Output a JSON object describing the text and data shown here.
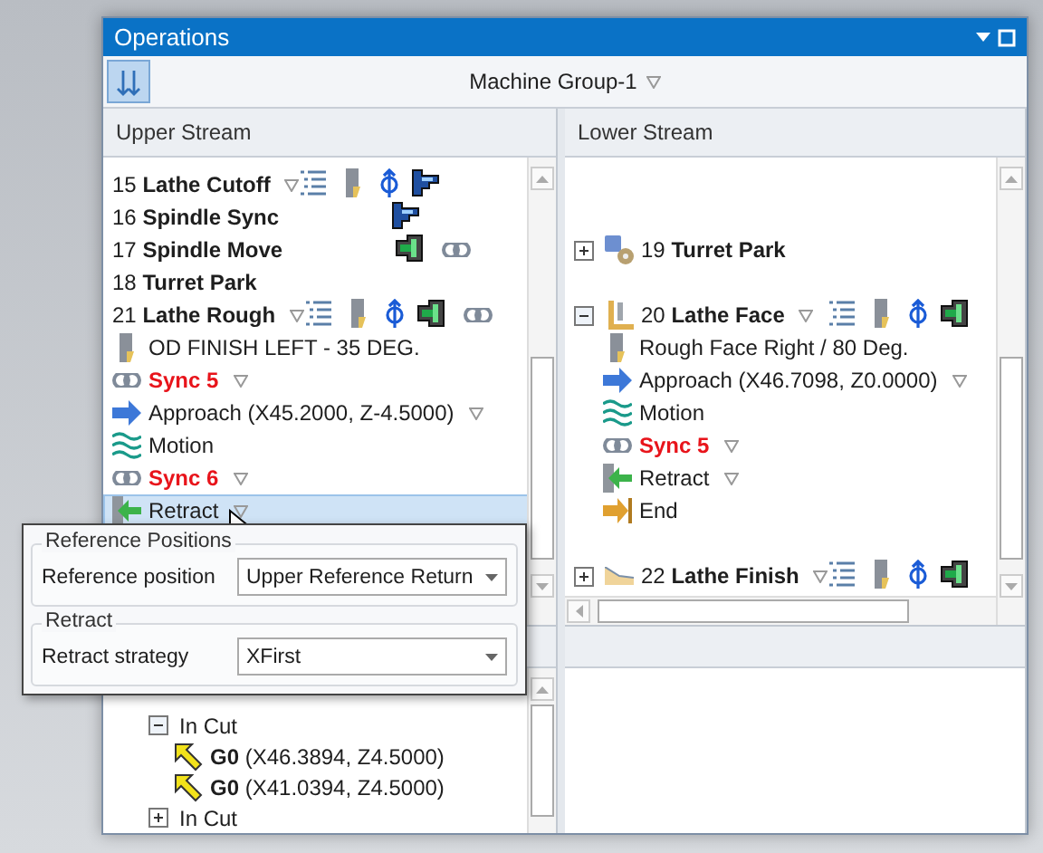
{
  "window": {
    "title": "Operations"
  },
  "toolbar": {
    "machine_group": "Machine Group-1",
    "has_menu": true
  },
  "upper_stream": {
    "title": "Upper Stream",
    "rows": [
      {
        "kind": "operation",
        "number": "15",
        "name": "Lathe Cutoff",
        "has_menu": true,
        "params": true,
        "tool": true,
        "axis": true,
        "spindle": {
          "kind": "sync"
        },
        "selected": false
      },
      {
        "kind": "operation",
        "number": "16",
        "name": "Spindle Sync",
        "spindle": {
          "kind": "sync"
        },
        "selected": false
      },
      {
        "kind": "operation",
        "number": "17",
        "name": "Spindle Move",
        "spindle": {
          "kind": "move"
        },
        "linked": true,
        "selected": false
      },
      {
        "kind": "operation",
        "number": "18",
        "name": "Turret Park",
        "selected": false
      },
      {
        "kind": "operation",
        "number": "21",
        "name": "Lathe Rough",
        "has_menu": true,
        "params": true,
        "tool": true,
        "axis": true,
        "spindle": {
          "kind": "move"
        },
        "linked": true,
        "selected": false
      },
      {
        "kind": "tool",
        "text": "OD FINISH LEFT - 35 DEG.",
        "selected": false
      },
      {
        "kind": "sync",
        "text": "Sync 5",
        "has_menu": true,
        "selected": false
      },
      {
        "kind": "approach",
        "text": "Approach (X45.2000, Z-4.5000)",
        "has_menu": true,
        "selected": false
      },
      {
        "kind": "motion",
        "text": "Motion",
        "selected": false
      },
      {
        "kind": "sync",
        "text": "Sync 6",
        "has_menu": true,
        "selected": false
      },
      {
        "kind": "retract",
        "text": "Retract",
        "has_menu": true,
        "selected": true
      }
    ]
  },
  "lower_stream": {
    "title": "Lower Stream",
    "rows": [
      {
        "kind": "park",
        "number": "19",
        "name": "Turret Park",
        "expanded": false,
        "selected": false
      },
      {
        "kind": "face",
        "number": "20",
        "name": "Lathe Face",
        "expanded": true,
        "has_menu": true,
        "params": true,
        "tool": true,
        "axis": true,
        "spindle": {
          "kind": "move"
        },
        "selected": false,
        "children": [
          {
            "kind": "tool",
            "text": "Rough Face Right / 80 Deg.",
            "selected": false
          },
          {
            "kind": "approach",
            "text": "Approach (X46.7098, Z0.0000)",
            "has_menu": true,
            "selected": false
          },
          {
            "kind": "motion",
            "text": "Motion",
            "selected": false
          },
          {
            "kind": "sync",
            "text": "Sync 5",
            "has_menu": true,
            "selected": false
          },
          {
            "kind": "retract",
            "text": "Retract",
            "has_menu": true,
            "selected": false
          },
          {
            "kind": "end",
            "text": "End",
            "selected": false
          }
        ]
      },
      {
        "kind": "finish",
        "number": "22",
        "name": "Lathe Finish",
        "expanded": false,
        "has_menu": true,
        "params": true,
        "tool": true,
        "axis": true,
        "spindle": {
          "kind": "move"
        },
        "selected": false
      }
    ]
  },
  "motion_tree": {
    "rows": [
      {
        "kind": "group",
        "text": "In Cut",
        "expanded": true,
        "selected": false,
        "children": [
          {
            "kind": "move",
            "text": "**G0** (X46.3894, Z4.5000)",
            "selected": false
          },
          {
            "kind": "move",
            "text": "**G0** (X41.0394, Z4.5000)",
            "selected": false
          }
        ]
      },
      {
        "kind": "group",
        "text": "In Cut",
        "expanded": false,
        "selected": false
      }
    ]
  },
  "popup": {
    "groups": [
      {
        "title": "Reference Positions",
        "fields": [
          {
            "label": "Reference position",
            "value": "Upper Reference Return"
          }
        ]
      },
      {
        "title": "Retract",
        "fields": [
          {
            "label": "Retract strategy",
            "value": "XFirst"
          }
        ]
      }
    ]
  }
}
